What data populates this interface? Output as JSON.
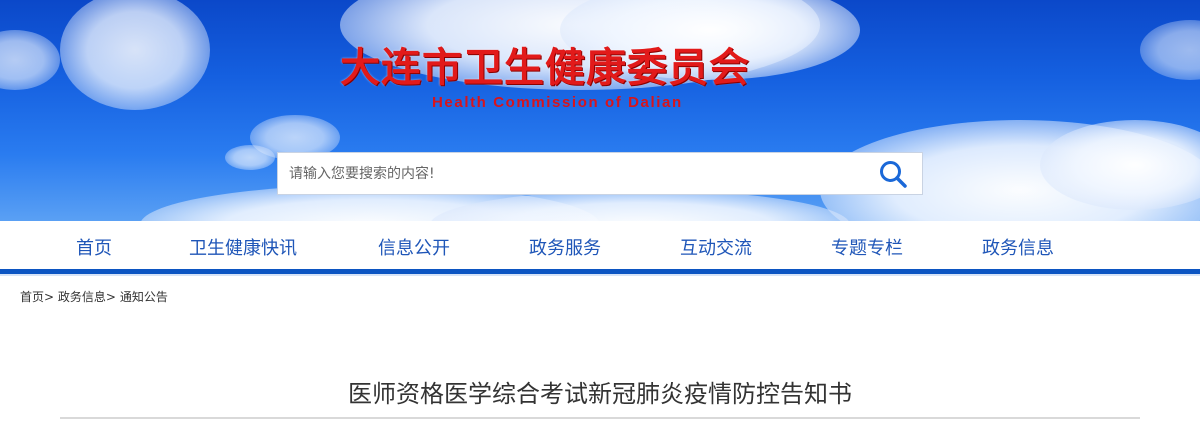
{
  "header": {
    "logo_cn": "大连市卫生健康委员会",
    "logo_en": "Health Commission of Dalian",
    "brand_red": "#e21a1a",
    "sky_blue": "#1560e0"
  },
  "search": {
    "placeholder": "请输入您要搜索的内容!",
    "icon": "search-icon"
  },
  "nav": {
    "accent": "#1f56b8",
    "items": [
      {
        "label": "首页"
      },
      {
        "label": "卫生健康快讯"
      },
      {
        "label": "信息公开"
      },
      {
        "label": "政务服务"
      },
      {
        "label": "互动交流"
      },
      {
        "label": "专题专栏"
      },
      {
        "label": "政务信息"
      }
    ]
  },
  "breadcrumb": {
    "items": [
      "首页",
      "政务信息",
      "通知公告"
    ],
    "separator": ">"
  },
  "article": {
    "title": "医师资格医学综合考试新冠肺炎疫情防控告知书"
  }
}
